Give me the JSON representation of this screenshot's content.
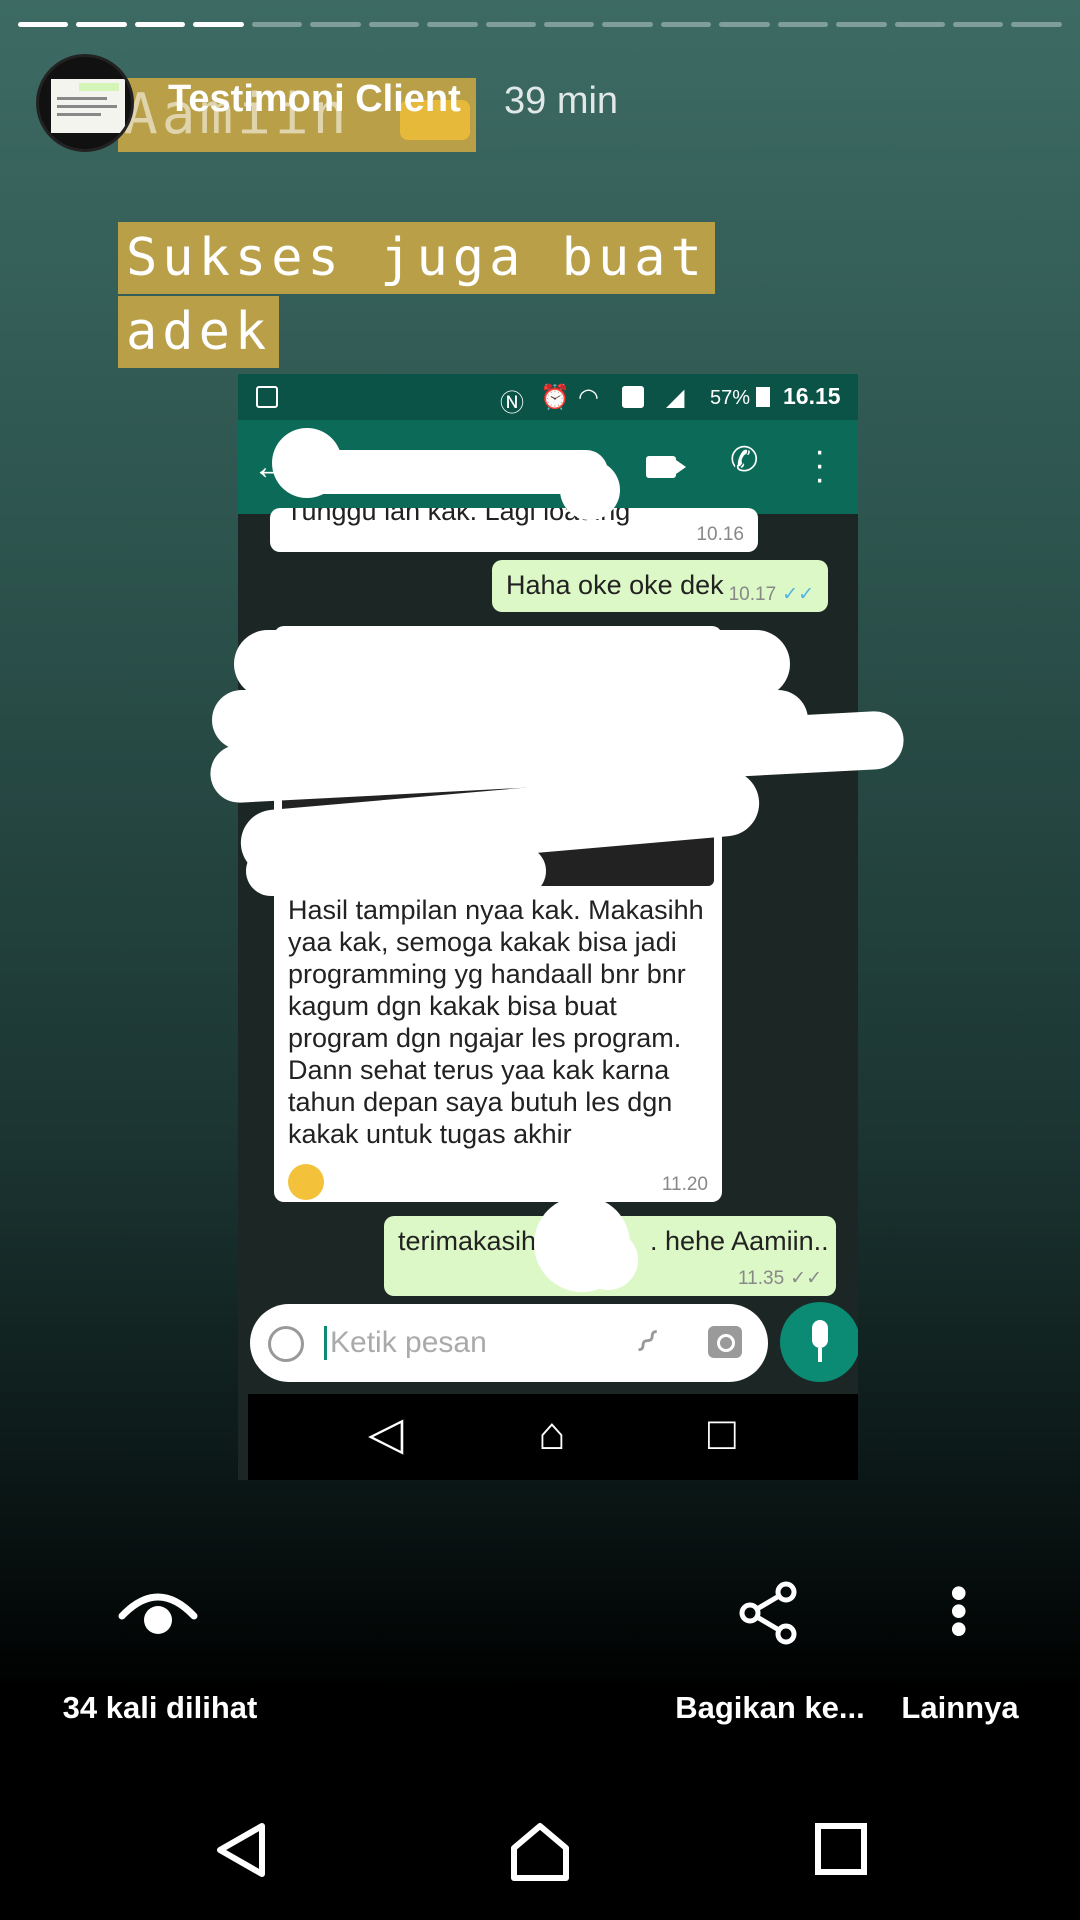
{
  "story": {
    "progress_total": 18,
    "progress_done": 4,
    "title": "Testimoni Client",
    "time": "39 min",
    "overlay_word": "Aamiin",
    "caption_lines": [
      "Sukses juga buat",
      "adek"
    ]
  },
  "chat": {
    "status": {
      "battery": "57%",
      "clock": "16.15"
    },
    "messages": [
      {
        "dir": "in",
        "text": "Tunggu lah kak. Lagi loading",
        "time": "10.16"
      },
      {
        "dir": "out",
        "text": "Haha oke oke dek",
        "time": "10.17"
      },
      {
        "dir": "in",
        "text": "Hasil tampilan nyaa kak. Makasihh yaa kak, semoga kakak bisa jadi programming yg handaall bnr bnr kagum dgn kakak bisa buat program dgn ngajar les program. Dann sehat terus yaa kak karna tahun depan saya butuh les dgn kakak untuk tugas akhir",
        "time": "11.20"
      },
      {
        "dir": "out",
        "text": "terimakasih",
        "text2": ". hehe Aamiin..",
        "time": "11.35"
      }
    ],
    "input_placeholder": "Ketik pesan"
  },
  "actions": {
    "views": "34 kali dilihat",
    "share": "Bagikan ke...",
    "more": "Lainnya"
  },
  "colors": {
    "caption_bg": "#b9a048",
    "chat_out": "#dcf8c6",
    "whatsapp": "#0b6b58"
  }
}
